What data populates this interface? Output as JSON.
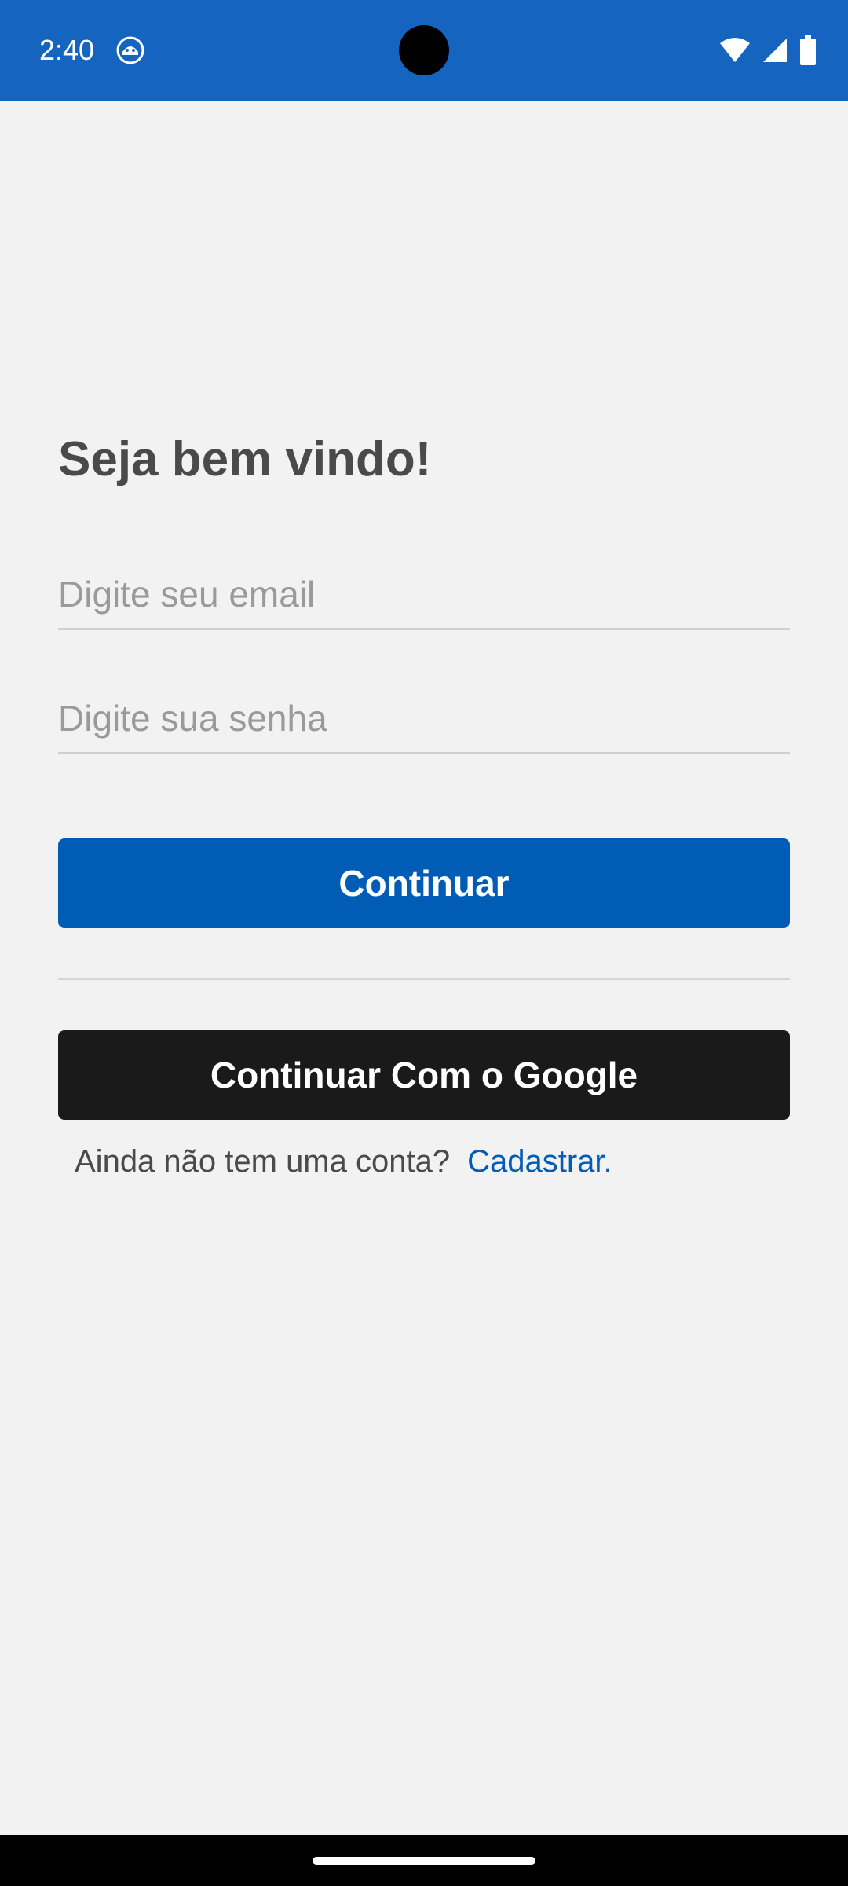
{
  "status_bar": {
    "time": "2:40",
    "app_icon": "android-debug-icon",
    "wifi_icon": "wifi-icon",
    "signal_icon": "cellular-signal-icon",
    "battery_icon": "battery-icon",
    "background_color": "#1565c0"
  },
  "login": {
    "title": "Seja bem vindo!",
    "email": {
      "value": "",
      "placeholder": "Digite seu email"
    },
    "password": {
      "value": "",
      "placeholder": "Digite sua senha"
    },
    "continue_label": "Continuar",
    "google_label": "Continuar Com o Google",
    "signup_prompt": "Ainda não tem uma conta?",
    "signup_link": "Cadastrar."
  },
  "colors": {
    "primary": "#005cb5",
    "google_button": "#1a1a1a",
    "background": "#f2f2f2",
    "title_text": "#4a4a4a"
  }
}
